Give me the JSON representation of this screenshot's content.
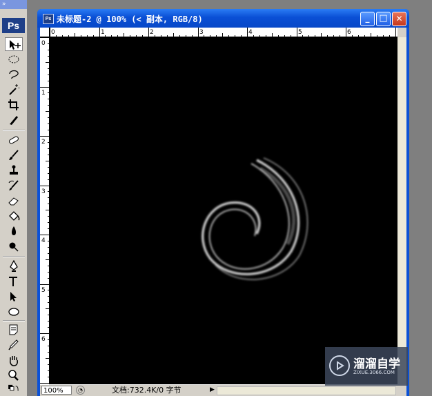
{
  "toolbox": {
    "grip_label": "»",
    "logo": "Ps",
    "tools": [
      {
        "name": "move-tool-icon",
        "selected": true
      },
      {
        "name": "elliptical-marquee-icon"
      },
      {
        "name": "lasso-icon"
      },
      {
        "name": "magic-wand-icon"
      },
      {
        "name": "crop-icon"
      },
      {
        "name": "slice-icon"
      },
      {
        "name": "healing-brush-icon"
      },
      {
        "name": "brush-icon"
      },
      {
        "name": "clone-stamp-icon"
      },
      {
        "name": "history-brush-icon"
      },
      {
        "name": "eraser-icon"
      },
      {
        "name": "paint-bucket-icon"
      },
      {
        "name": "blur-icon"
      },
      {
        "name": "dodge-icon"
      },
      {
        "name": "pen-icon"
      },
      {
        "name": "type-icon"
      },
      {
        "name": "path-selection-icon"
      },
      {
        "name": "ellipse-shape-icon"
      },
      {
        "name": "notes-icon"
      },
      {
        "name": "eyedropper-icon"
      },
      {
        "name": "hand-icon"
      },
      {
        "name": "zoom-icon"
      }
    ]
  },
  "window": {
    "app_icon": "Ps",
    "title": "未标题-2 @ 100% (< 副本, RGB/8)",
    "minimize_glyph": "_",
    "maximize_glyph": "□",
    "close_glyph": "✕"
  },
  "rulers": {
    "top_labels": [
      "0",
      "1",
      "2",
      "3",
      "4",
      "5",
      "6"
    ],
    "left_labels": [
      "0",
      "1",
      "2",
      "3",
      "4",
      "5",
      "6"
    ]
  },
  "status": {
    "zoom": "100%",
    "doc_info": "文档:732.4K/0 字节",
    "arrow_glyph": "▶"
  },
  "watermark": {
    "brand": "溜溜自学",
    "site": "ZIXUE.3066.COM"
  },
  "colors": {
    "canvas": "#000000",
    "titlebar": "#0a4fd5",
    "swirl": "#cfcfcf"
  }
}
